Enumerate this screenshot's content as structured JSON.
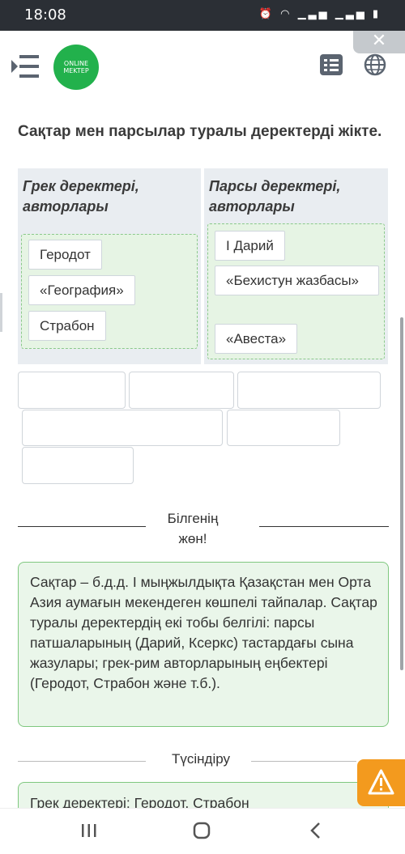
{
  "status_bar": {
    "time": "18:08",
    "icons": [
      "alarm-icon",
      "wifi-icon",
      "signal-icon",
      "signal-icon",
      "battery-icon"
    ]
  },
  "header": {
    "logo_line1": "ONLINE",
    "logo_line2": "MEKTEP",
    "close_symbol": "✕"
  },
  "task": {
    "title": "Сақтар мен парсылар туралы деректерді жікте."
  },
  "columns": [
    {
      "title": "Грек деректері, авторлары",
      "items": [
        "Геродот",
        "«География»",
        "Страбон"
      ]
    },
    {
      "title": "Парсы деректері, авторлары",
      "items": [
        "І Дарий",
        "«Бехистун жазбасы»",
        "«Авеста»"
      ]
    }
  ],
  "know_label": "Білгенің жөн!",
  "info_text": "Сақтар – б.д.д. І мыңжылдықта Қазақстан мен Орта Азия аумағын мекендеген көшпелі тайпалар. Сақтар туралы деректердің екі тобы белгілі: парсы патшаларының (Дарий, Ксеркс) тастардағы сына жазулары; грек-рим авторларының еңбектері (Геродот, Страбон және т.б.).",
  "explain_label": "Түсіндіру",
  "answer_preview": "Грек деректері: Геродот, Страбон",
  "colors": {
    "status_bar": "#2b2f35",
    "logo_green": "#22b14c",
    "info_border": "#7fc87f",
    "info_bg": "#eaf6ea",
    "warning": "#f39a1e",
    "column_bg": "#e9edf1"
  }
}
